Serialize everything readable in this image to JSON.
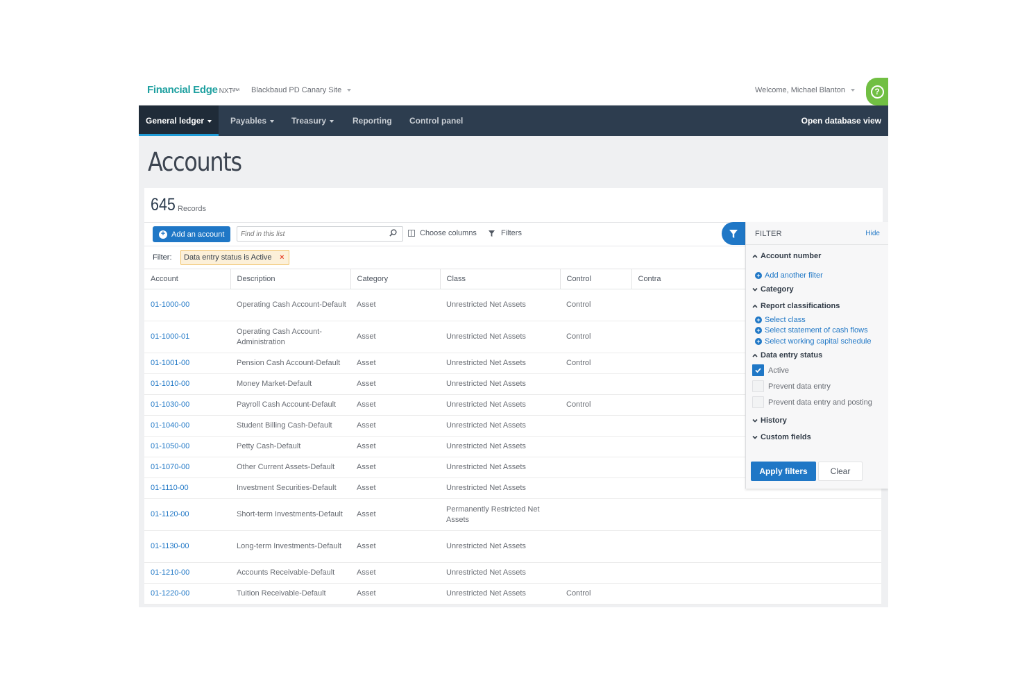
{
  "topbar": {
    "brand": "Financial Edge",
    "brand_sub": "NXT™",
    "site": "Blackbaud PD Canary Site",
    "welcome": "Welcome, Michael Blanton",
    "help_glyph": "?"
  },
  "nav": {
    "items": [
      {
        "label": "General ledger"
      },
      {
        "label": "Payables"
      },
      {
        "label": "Treasury"
      },
      {
        "label": "Reporting"
      },
      {
        "label": "Control panel"
      }
    ],
    "right": "Open database view"
  },
  "page": {
    "title": "Accounts",
    "records_count": "645",
    "records_label": "Records"
  },
  "toolbar": {
    "add_label": "Add an account",
    "search_placeholder": "Find in this list",
    "choose_columns": "Choose columns",
    "filters": "Filters"
  },
  "active_filter": {
    "label": "Filter:",
    "chip": "Data entry status is Active",
    "remove_glyph": "×"
  },
  "table": {
    "columns": [
      "Account",
      "Description",
      "Category",
      "Class",
      "Control",
      "Contra"
    ],
    "rows": [
      {
        "account": "01-1000-00",
        "description": "Operating Cash Account-Default",
        "category": "Asset",
        "class": "Unrestricted Net Assets",
        "control": "Control",
        "contra": ""
      },
      {
        "account": "01-1000-01",
        "description": "Operating Cash Account-Administration",
        "category": "Asset",
        "class": "Unrestricted Net Assets",
        "control": "Control",
        "contra": ""
      },
      {
        "account": "01-1001-00",
        "description": "Pension Cash Account-Default",
        "category": "Asset",
        "class": "Unrestricted Net Assets",
        "control": "Control",
        "contra": ""
      },
      {
        "account": "01-1010-00",
        "description": "Money Market-Default",
        "category": "Asset",
        "class": "Unrestricted Net Assets",
        "control": "",
        "contra": ""
      },
      {
        "account": "01-1030-00",
        "description": "Payroll Cash Account-Default",
        "category": "Asset",
        "class": "Unrestricted Net Assets",
        "control": "Control",
        "contra": ""
      },
      {
        "account": "01-1040-00",
        "description": "Student Billing Cash-Default",
        "category": "Asset",
        "class": "Unrestricted Net Assets",
        "control": "",
        "contra": ""
      },
      {
        "account": "01-1050-00",
        "description": "Petty Cash-Default",
        "category": "Asset",
        "class": "Unrestricted Net Assets",
        "control": "",
        "contra": ""
      },
      {
        "account": "01-1070-00",
        "description": "Other Current Assets-Default",
        "category": "Asset",
        "class": "Unrestricted Net Assets",
        "control": "",
        "contra": ""
      },
      {
        "account": "01-1110-00",
        "description": "Investment Securities-Default",
        "category": "Asset",
        "class": "Unrestricted Net Assets",
        "control": "",
        "contra": ""
      },
      {
        "account": "01-1120-00",
        "description": "Short-term Investments-Default",
        "category": "Asset",
        "class": "Permanently Restricted Net Assets",
        "control": "",
        "contra": ""
      },
      {
        "account": "01-1130-00",
        "description": "Long-term Investments-Default",
        "category": "Asset",
        "class": "Unrestricted Net Assets",
        "control": "",
        "contra": ""
      },
      {
        "account": "01-1210-00",
        "description": "Accounts Receivable-Default",
        "category": "Asset",
        "class": "Unrestricted Net Assets",
        "control": "",
        "contra": ""
      },
      {
        "account": "01-1220-00",
        "description": "Tuition Receivable-Default",
        "category": "Asset",
        "class": "Unrestricted Net Assets",
        "control": "Control",
        "contra": ""
      }
    ]
  },
  "filter_panel": {
    "title": "FILTER",
    "hide": "Hide",
    "account_number": "Account number",
    "add_another": "Add another filter",
    "category": "Category",
    "report_classifications": "Report classifications",
    "report_links": [
      "Select class",
      "Select statement of cash flows",
      "Select working capital schedule"
    ],
    "data_entry_status": "Data entry status",
    "statuses": [
      {
        "label": "Active",
        "checked": true
      },
      {
        "label": "Prevent data entry",
        "checked": false
      },
      {
        "label": "Prevent data entry and posting",
        "checked": false
      }
    ],
    "history": "History",
    "custom_fields": "Custom fields",
    "apply": "Apply filters",
    "clear": "Clear"
  },
  "colors": {
    "brand": "#1ea0a0",
    "nav_bg": "#2d3d4f",
    "primary_blue": "#1f77c6",
    "help_green": "#71bf43",
    "chip_bg": "#fcf0d9",
    "chip_border": "#f1c36a",
    "chip_remove": "#e64a32"
  },
  "icons": {
    "help": "question-circle-icon",
    "add": "plus-circle-icon",
    "search": "search-icon",
    "columns": "columns-icon",
    "filter": "funnel-icon",
    "expand": "chevron-down-icon",
    "collapse": "chevron-up-icon",
    "check": "check-icon"
  }
}
